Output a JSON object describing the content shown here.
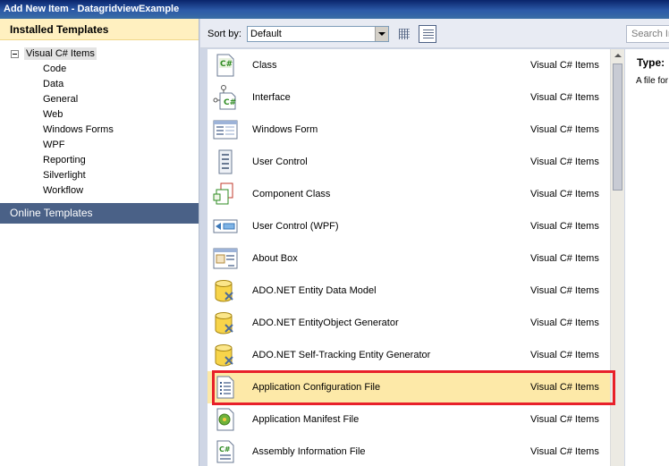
{
  "window": {
    "title": "Add New Item - DatagridviewExample"
  },
  "left": {
    "header": "Installed Templates",
    "tree_root": "Visual C# Items",
    "children": [
      "Code",
      "Data",
      "General",
      "Web",
      "Windows Forms",
      "WPF",
      "Reporting",
      "Silverlight",
      "Workflow"
    ],
    "online": "Online Templates"
  },
  "toolbar": {
    "sort_label": "Sort by:",
    "sort_value": "Default",
    "search_placeholder": "Search Installed Templates"
  },
  "items": [
    {
      "name": "Class",
      "category": "Visual C# Items",
      "icon": "csharp-class-icon"
    },
    {
      "name": "Interface",
      "category": "Visual C# Items",
      "icon": "csharp-interface-icon"
    },
    {
      "name": "Windows Form",
      "category": "Visual C# Items",
      "icon": "windows-form-icon"
    },
    {
      "name": "User Control",
      "category": "Visual C# Items",
      "icon": "user-control-icon"
    },
    {
      "name": "Component Class",
      "category": "Visual C# Items",
      "icon": "component-class-icon"
    },
    {
      "name": "User Control (WPF)",
      "category": "Visual C# Items",
      "icon": "wpf-user-control-icon"
    },
    {
      "name": "About Box",
      "category": "Visual C# Items",
      "icon": "about-box-icon"
    },
    {
      "name": "ADO.NET Entity Data Model",
      "category": "Visual C# Items",
      "icon": "entity-data-model-icon"
    },
    {
      "name": "ADO.NET EntityObject Generator",
      "category": "Visual C# Items",
      "icon": "entityobject-generator-icon"
    },
    {
      "name": "ADO.NET Self-Tracking Entity Generator",
      "category": "Visual C# Items",
      "icon": "self-tracking-entity-icon"
    },
    {
      "name": "Application Configuration File",
      "category": "Visual C# Items",
      "icon": "config-file-icon",
      "selected": true
    },
    {
      "name": "Application Manifest File",
      "category": "Visual C# Items",
      "icon": "manifest-file-icon"
    },
    {
      "name": "Assembly Information File",
      "category": "Visual C# Items",
      "icon": "assembly-info-icon"
    }
  ],
  "details": {
    "type_label": "Type:",
    "description": "A file for storing application settings"
  },
  "colors": {
    "selection": "#fde9a8",
    "highlight_border": "#e8202a",
    "online_bg": "#4a6187"
  }
}
